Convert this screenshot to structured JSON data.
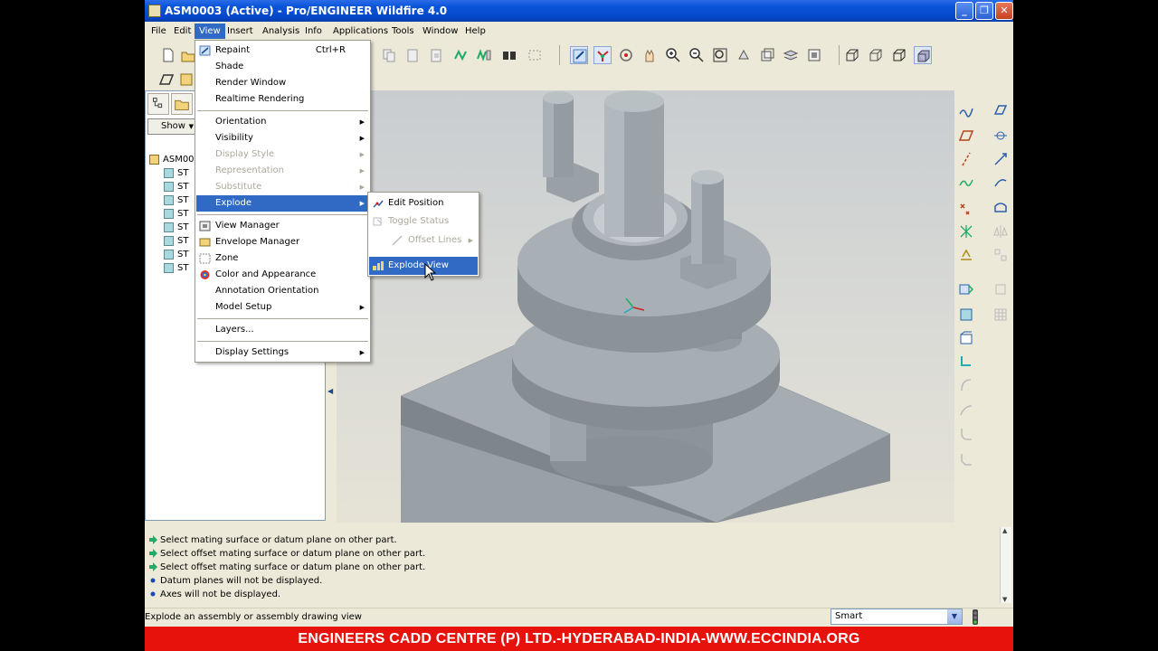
{
  "window": {
    "title": "ASM0003 (Active) - Pro/ENGINEER Wildfire 4.0"
  },
  "menubar": [
    {
      "label": "File"
    },
    {
      "label": "Edit"
    },
    {
      "label": "View",
      "active": true
    },
    {
      "label": "Insert"
    },
    {
      "label": "Analysis"
    },
    {
      "label": "Info"
    },
    {
      "label": "Applications"
    },
    {
      "label": "Tools"
    },
    {
      "label": "Window"
    },
    {
      "label": "Help"
    }
  ],
  "view_menu": {
    "items": [
      {
        "label": "Repaint",
        "shortcut": "Ctrl+R",
        "icon": "repaint-icon"
      },
      {
        "label": "Shade"
      },
      {
        "label": "Render Window"
      },
      {
        "label": "Realtime Rendering"
      },
      {
        "label": "Orientation",
        "submenu": true
      },
      {
        "label": "Visibility",
        "submenu": true
      },
      {
        "label": "Display Style",
        "submenu": true,
        "disabled": true
      },
      {
        "label": "Representation",
        "submenu": true,
        "disabled": true
      },
      {
        "label": "Substitute",
        "submenu": true,
        "disabled": true
      },
      {
        "label": "Explode",
        "submenu": true,
        "highlighted": true
      },
      {
        "label": "View Manager",
        "icon": "view-manager-icon"
      },
      {
        "label": "Envelope Manager",
        "icon": "envelope-manager-icon"
      },
      {
        "label": "Zone",
        "icon": "zone-icon"
      },
      {
        "label": "Color and Appearance",
        "icon": "color-appearance-icon"
      },
      {
        "label": "Annotation Orientation"
      },
      {
        "label": "Model Setup",
        "submenu": true
      },
      {
        "label": "Layers..."
      },
      {
        "label": "Display Settings",
        "submenu": true
      }
    ]
  },
  "explode_menu": {
    "items": [
      {
        "label": "Edit Position",
        "icon": "edit-position-icon"
      },
      {
        "label": "Toggle Status",
        "disabled": true,
        "icon": "toggle-status-icon"
      },
      {
        "label": "Offset Lines",
        "disabled": true,
        "submenu": true,
        "icon": "offset-lines-icon"
      },
      {
        "label": "Explode View",
        "highlighted": true,
        "icon": "explode-view-icon"
      }
    ]
  },
  "model_tree": {
    "show_label": "Show",
    "root": "ASM00",
    "children": [
      "ST",
      "ST",
      "ST",
      "ST",
      "ST",
      "ST",
      "ST",
      "ST"
    ]
  },
  "messages": [
    {
      "text": "Select mating surface or datum plane on other part.",
      "type": "prompt"
    },
    {
      "text": "Select offset mating surface or datum plane on other part.",
      "type": "prompt"
    },
    {
      "text": "Select offset mating surface or datum plane on other part.",
      "type": "prompt"
    },
    {
      "text": "Datum planes will not be displayed.",
      "type": "info"
    },
    {
      "text": "Axes will not be displayed.",
      "type": "info"
    }
  ],
  "status": {
    "text": "Explode an assembly or assembly drawing view",
    "filter_value": "Smart"
  },
  "banner": {
    "text": "ENGINEERS CADD CENTRE (P) LTD.-HYDERABAD-INDIA-WWW.ECCINDIA.ORG"
  },
  "colors": {
    "titlebar": "#0a55d9",
    "menu_highlight": "#316ac5",
    "banner": "#e8120c",
    "model_gray": "#9aa1a6"
  }
}
